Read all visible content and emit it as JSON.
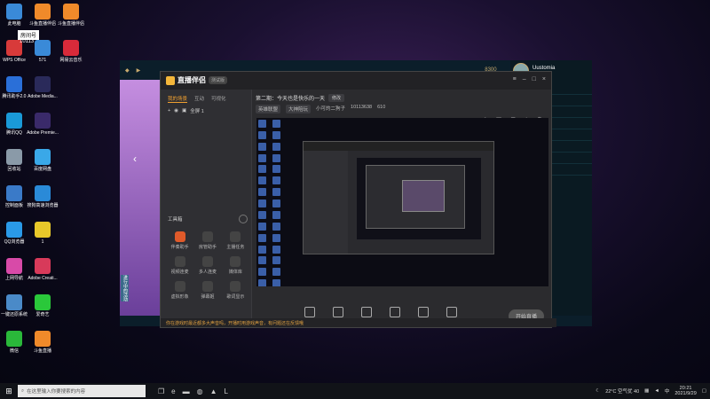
{
  "desktop": {
    "top_left_overlay": "房间号",
    "top_left_number": "10113",
    "icons": [
      {
        "label": "此电脑",
        "color": "#3a8ad8"
      },
      {
        "label": "WPS Office",
        "color": "#d83a3a"
      },
      {
        "label": "腾讯助手2.0",
        "color": "#2a6fd8"
      },
      {
        "label": "腾讯QQ",
        "color": "#1a9ad8"
      },
      {
        "label": "回收站",
        "color": "#8a9aa8"
      },
      {
        "label": "控制面板",
        "color": "#3a7ac8"
      },
      {
        "label": "QQ浏览器",
        "color": "#2a9ae8"
      },
      {
        "label": "上网导航",
        "color": "#d84aa8"
      },
      {
        "label": "一键还原系统",
        "color": "#4a8ac8"
      },
      {
        "label": "微信",
        "color": "#2ab83a"
      }
    ],
    "icons_col2": [
      {
        "label": "斗鱼直播伴侣",
        "color": "#f08a2a"
      },
      {
        "label": "571",
        "color": "#3a8ad8"
      },
      {
        "label": "Adobe Media...",
        "color": "#2a2a5a"
      },
      {
        "label": "Adobe Premie...",
        "color": "#3a2a6a"
      },
      {
        "label": "百度网盘",
        "color": "#3aa8e8"
      },
      {
        "label": "搜狗高速浏览器",
        "color": "#2a8ad8"
      },
      {
        "label": "1",
        "color": "#e8c82a"
      },
      {
        "label": "Adobe Creati...",
        "color": "#d83a5a"
      },
      {
        "label": "爱奇艺",
        "color": "#2ac83a"
      },
      {
        "label": "斗鱼直播",
        "color": "#f08a2a"
      }
    ],
    "icons_col3": [
      {
        "label": "斗鱼直播伴侣",
        "color": "#f08a2a"
      },
      {
        "label": "网易云音乐",
        "color": "#d82a3a"
      }
    ]
  },
  "lol_client": {
    "username": "Uustomia",
    "status": "在线",
    "currency": "8300",
    "sidebar_tag": "进行中的活动"
  },
  "app": {
    "name": "直播伴侣",
    "version": "测试版",
    "tabs": [
      "我的场景",
      "互动",
      "可视化"
    ],
    "scene_label": "全屏 1",
    "live_title": "第二期：今天也是快乐的一天",
    "edit_label": "修改",
    "live_sub": [
      "英雄联盟",
      "大神陪玩",
      "小可的二狗子",
      "10113638",
      "610"
    ],
    "toolbox_title": "工具箱",
    "tools": [
      {
        "label": "伴奏助手",
        "hot": true
      },
      {
        "label": "房管助手",
        "hot": false
      },
      {
        "label": "主播任务",
        "hot": false
      },
      {
        "label": "视频连麦",
        "hot": false
      },
      {
        "label": "多人连麦",
        "hot": false
      },
      {
        "label": "媒体库",
        "hot": false
      },
      {
        "label": "虚拟形象",
        "hot": false
      },
      {
        "label": "弹幕姬",
        "hot": false
      },
      {
        "label": "歌词显示",
        "hot": false
      }
    ],
    "bottom_buttons": [
      "直播弹幕",
      "摄像头",
      "手机投屏",
      "多媒体",
      "麦克风",
      "扬声器"
    ],
    "start_live": "开始直播",
    "status_text": "你在游戏时最近都多大声音吗，开播时用游戏声音，有问题还在反馈哦"
  },
  "taskbar": {
    "search_placeholder": "在这里输入你要搜索的内容",
    "weather": "22°C 空气优 40",
    "time": "20:21",
    "date": "2021/9/29"
  }
}
